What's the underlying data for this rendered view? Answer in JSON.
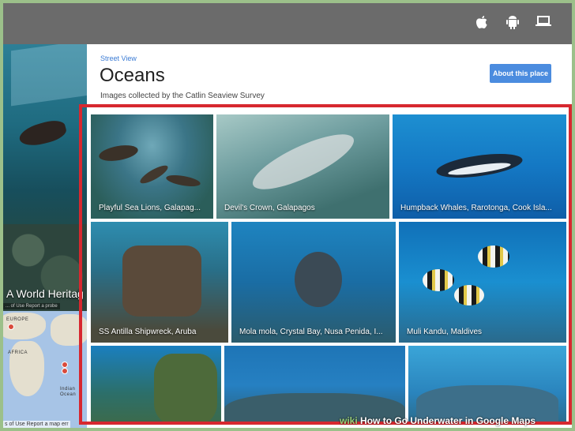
{
  "topbar": {
    "icons": [
      "apple-icon",
      "android-icon",
      "laptop-icon"
    ]
  },
  "left": {
    "caption": "A World Heritag",
    "links": "... of Use   Report a probe",
    "map_labels": {
      "europe": "EUROPE",
      "africa": "AFRICA",
      "indian_ocean_1": "Indian",
      "indian_ocean_2": "Ocean"
    },
    "map_footer": "s of Use   Report a map err"
  },
  "panel": {
    "breadcrumb": "Street View",
    "title": "Oceans",
    "subtitle": "Images collected by the Catlin Seaview Survey",
    "about_button": "About this place"
  },
  "tiles": [
    {
      "caption": "Playful Sea Lions, Galapag..."
    },
    {
      "caption": "Devil's Crown, Galapagos"
    },
    {
      "caption": "Humpback Whales, Rarotonga, Cook Isla..."
    },
    {
      "caption": "SS Antilla Shipwreck, Aruba"
    },
    {
      "caption": "Mola mola, Crystal Bay, Nusa Penida, I..."
    },
    {
      "caption": "Muli Kandu, Maldives"
    },
    {
      "caption": ""
    },
    {
      "caption": ""
    },
    {
      "caption": ""
    }
  ],
  "watermark": {
    "brand": "wiki",
    "text": "How to Go Underwater in Google Maps"
  },
  "colors": {
    "accent_blue": "#4b8cdf",
    "highlight_red": "#d7282f",
    "topbar_gray": "#6b6b6b"
  }
}
